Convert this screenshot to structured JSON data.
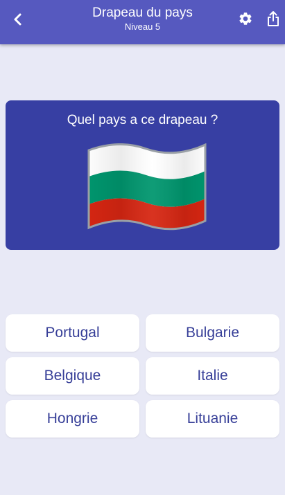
{
  "header": {
    "title": "Drapeau du pays",
    "subtitle": "Niveau 5",
    "background": "#5659bf"
  },
  "icons": {
    "back": "chevron-left-icon",
    "settings": "gear-icon",
    "share": "share-icon"
  },
  "question": {
    "text": "Quel pays a ce drapeau ?",
    "card_color": "#373fa3",
    "flag": "bulgaria-flag",
    "flag_colors": [
      "#ffffff",
      "#00966e",
      "#d62612"
    ]
  },
  "answers": [
    "Portugal",
    "Bulgarie",
    "Belgique",
    "Italie",
    "Hongrie",
    "Lituanie"
  ]
}
